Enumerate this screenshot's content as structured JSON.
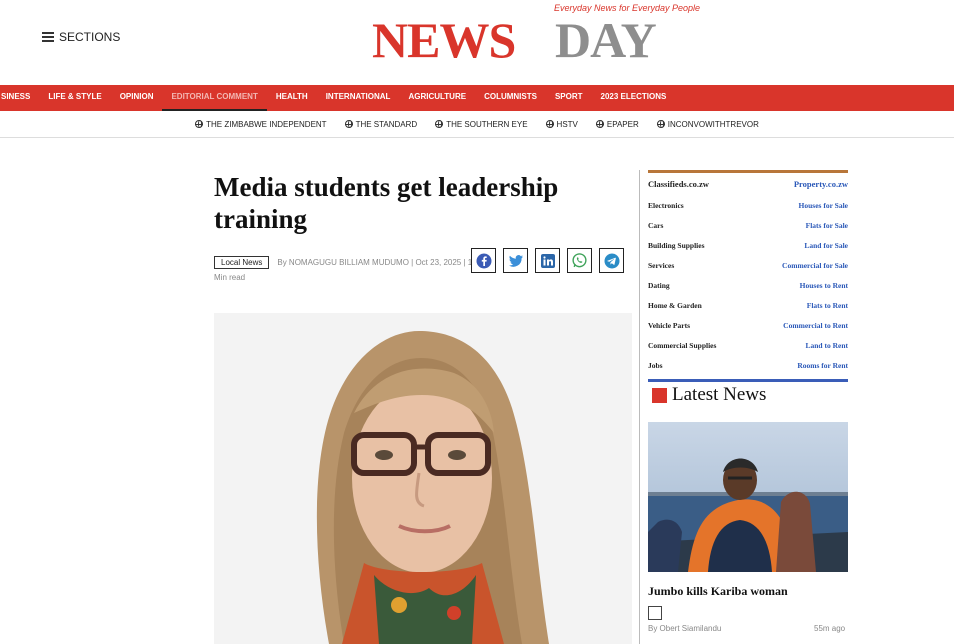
{
  "header": {
    "sections_label": "SECTIONS",
    "logo_news": "NEWS",
    "logo_day": "DAY",
    "tagline": "Everyday News for Everyday People"
  },
  "nav": {
    "items": [
      "SINESS",
      "LIFE & STYLE",
      "OPINION",
      "EDITORIAL COMMENT",
      "HEALTH",
      "INTERNATIONAL",
      "AGRICULTURE",
      "COLUMNISTS",
      "SPORT",
      "2023 ELECTIONS"
    ],
    "active": "EDITORIAL COMMENT"
  },
  "sublinks": [
    "THE ZIMBABWE INDEPENDENT",
    "THE STANDARD",
    "THE SOUTHERN EYE",
    "HSTV",
    "EPAPER",
    "INCONVOWITHTREVOR"
  ],
  "article": {
    "title": "Media students get leadership training",
    "tag": "Local News",
    "byline": "By NOMAGUGU BILLIAM MUDUMO | Oct 23, 2025 | 1",
    "read_time": "Min read"
  },
  "share_icons": [
    "facebook-icon",
    "twitter-icon",
    "linkedin-icon",
    "whatsapp-icon",
    "telegram-icon"
  ],
  "classifieds": {
    "left_title": "Classifieds.co.zw",
    "right_title": "Property.co.zw",
    "rows": [
      {
        "left": "Electronics",
        "right": "Houses for Sale"
      },
      {
        "left": "Cars",
        "right": "Flats for Sale"
      },
      {
        "left": "Building Supplies",
        "right": "Land for Sale"
      },
      {
        "left": "Services",
        "right": "Commercial for Sale"
      },
      {
        "left": "Dating",
        "right": "Houses to Rent"
      },
      {
        "left": "Home & Garden",
        "right": "Flats to Rent"
      },
      {
        "left": "Vehicle Parts",
        "right": "Commercial to Rent"
      },
      {
        "left": "Commercial Supplies",
        "right": "Land to Rent"
      },
      {
        "left": "Jobs",
        "right": "Rooms for Rent"
      }
    ]
  },
  "latest": {
    "heading": "Latest News",
    "item_title": "Jumbo kills Kariba woman",
    "item_author": "By Obert Siamilandu",
    "item_age": "55m ago"
  },
  "colors": {
    "brand_red": "#d9352b",
    "logo_gray": "#8e8e8e",
    "link_blue": "#2a58b8"
  }
}
